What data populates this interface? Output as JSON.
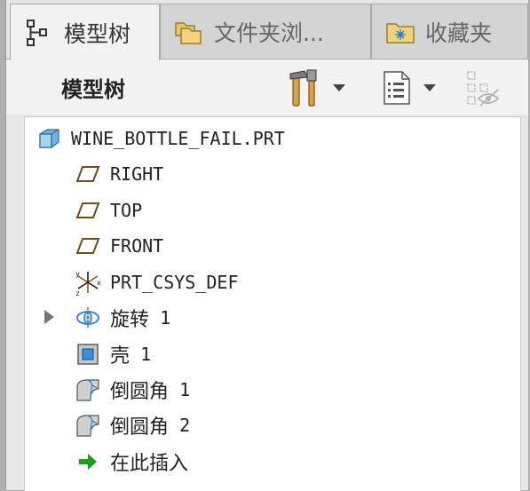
{
  "tabs": [
    {
      "label": "模型树",
      "icon": "model-tree-icon",
      "active": true
    },
    {
      "label": "文件夹浏...",
      "icon": "folder-browser-icon",
      "active": false
    },
    {
      "label": "收藏夹",
      "icon": "favorites-icon",
      "active": false
    }
  ],
  "toolbar": {
    "title": "模型树",
    "settings_icon": "tools-settings-icon",
    "show_icon": "tree-columns-icon",
    "filter_icon": "visibility-filter-icon"
  },
  "tree": {
    "root": "WINE_BOTTLE_FAIL.PRT",
    "items": [
      {
        "label": "RIGHT",
        "icon": "datum-plane-icon"
      },
      {
        "label": "TOP",
        "icon": "datum-plane-icon"
      },
      {
        "label": "FRONT",
        "icon": "datum-plane-icon"
      },
      {
        "label": "PRT_CSYS_DEF",
        "icon": "coordinate-system-icon"
      },
      {
        "name": "旋转",
        "num": "1",
        "icon": "revolve-icon"
      },
      {
        "name": "壳",
        "num": "1",
        "icon": "shell-icon"
      },
      {
        "name": "倒圆角",
        "num": "1",
        "icon": "round-icon"
      },
      {
        "name": "倒圆角",
        "num": "2",
        "icon": "round-icon"
      },
      {
        "name": "在此插入",
        "icon": "insert-here-arrow-icon"
      }
    ]
  },
  "colors": {
    "insert_arrow": "#1aa01a",
    "part_icon": "#6fb3e0"
  }
}
